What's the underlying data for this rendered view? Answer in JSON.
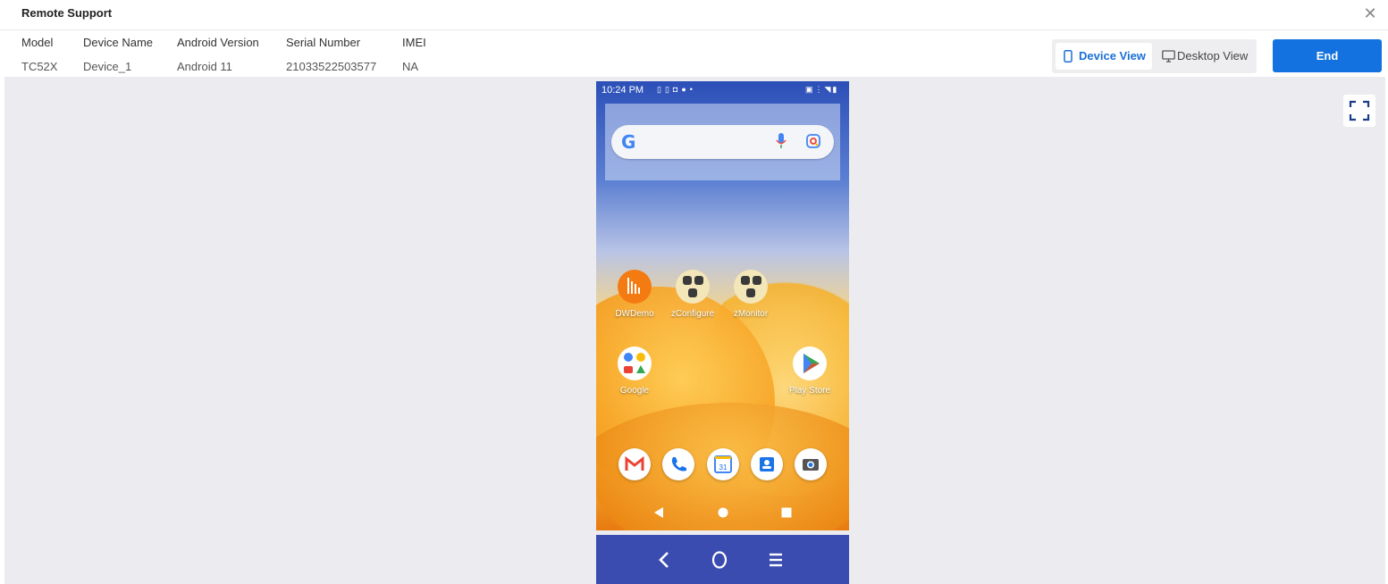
{
  "window": {
    "title": "Remote Support"
  },
  "device_info": {
    "columns": [
      {
        "header": "Model",
        "value": "TC52X"
      },
      {
        "header": "Device Name",
        "value": "Device_1"
      },
      {
        "header": "Android Version",
        "value": "Android 11"
      },
      {
        "header": "Serial Number",
        "value": "21033522503577"
      },
      {
        "header": "IMEI",
        "value": "NA"
      }
    ]
  },
  "view_toggle": {
    "device_view": "Device View",
    "desktop_view": "Desktop View",
    "selected": "Device View"
  },
  "end_button": "End",
  "phone": {
    "status_time": "10:24 PM",
    "apps": [
      {
        "name": "DWDemo"
      },
      {
        "name": "zConfigure"
      },
      {
        "name": "zMonitor"
      },
      {
        "name": "Google"
      },
      {
        "name": "Play Store"
      }
    ],
    "dock_icons": [
      "gmail-icon",
      "phone-icon",
      "calendar-icon",
      "contacts-icon",
      "camera-icon"
    ],
    "calendar_day": "31"
  },
  "colors": {
    "accent": "#1372df",
    "remote_nav": "#3a4caf",
    "canvas": "#ececf0"
  }
}
